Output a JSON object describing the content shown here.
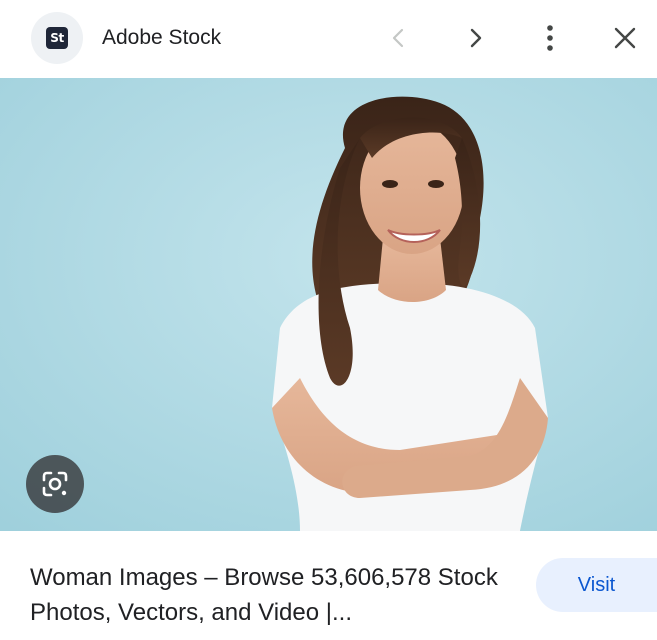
{
  "header": {
    "source_logo_text": "St",
    "source_name": "Adobe Stock",
    "icons": {
      "previous": "chevron-left-icon",
      "next": "chevron-right-icon",
      "more": "more-vert-icon",
      "close": "close-icon"
    }
  },
  "image": {
    "lens_icon": "lens-icon",
    "background_color": "#a8d6e0"
  },
  "result": {
    "title": "Woman Images – Browse 53,606,578 Stock Photos, Vectors, and Video |...",
    "visit_label": "Visit"
  },
  "colors": {
    "accent": "#0b57d0",
    "visit_bg": "#e8f0fe",
    "text": "#202124",
    "icon_disabled": "#c4c7c5",
    "icon": "#444746"
  }
}
